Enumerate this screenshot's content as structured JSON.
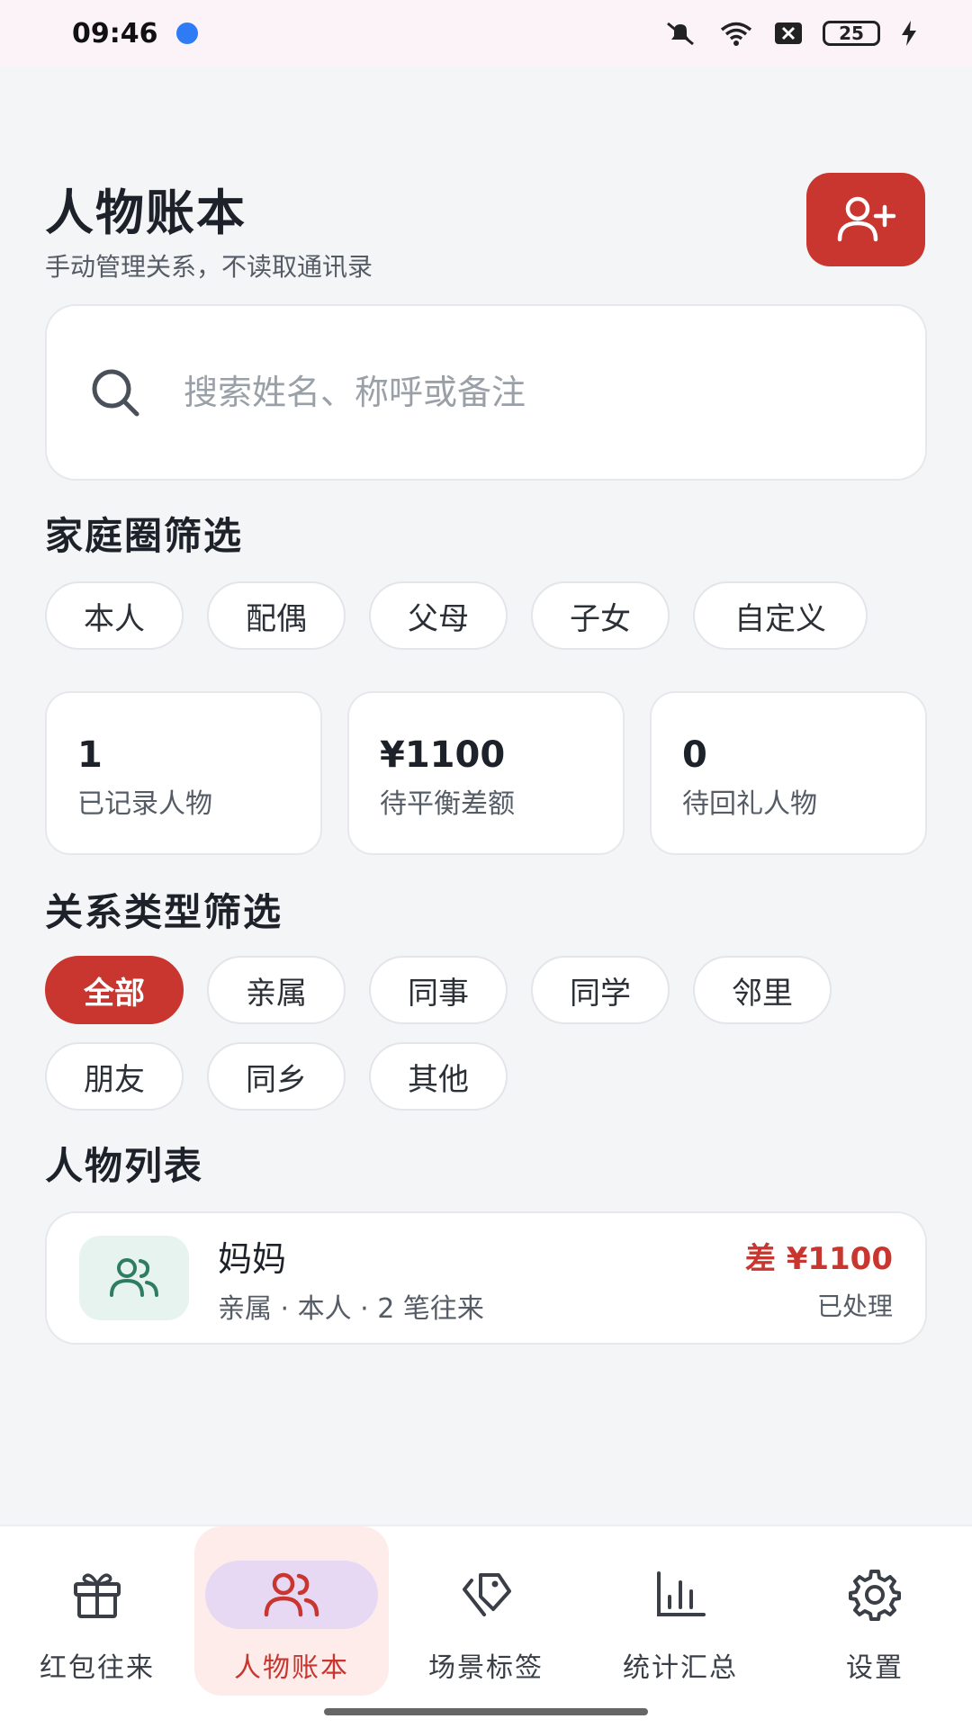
{
  "status_bar": {
    "time": "09:46",
    "battery": "25"
  },
  "header": {
    "title": "人物账本",
    "subtitle": "手动管理关系，不读取通讯录",
    "add_icon": "user-plus-icon"
  },
  "search": {
    "placeholder": "搜索姓名、称呼或备注",
    "value": ""
  },
  "family_filter": {
    "title": "家庭圈筛选",
    "chips": [
      "本人",
      "配偶",
      "父母",
      "子女",
      "自定义"
    ]
  },
  "stats": [
    {
      "value": "1",
      "label": "已记录人物"
    },
    {
      "value": "¥1100",
      "label": "待平衡差额"
    },
    {
      "value": "0",
      "label": "待回礼人物"
    }
  ],
  "relation_filter": {
    "title": "关系类型筛选",
    "row1": [
      "全部",
      "亲属",
      "同事",
      "同学",
      "邻里"
    ],
    "row2": [
      "朋友",
      "同乡",
      "其他"
    ],
    "selected": "全部"
  },
  "people": {
    "title": "人物列表",
    "items": [
      {
        "name": "妈妈",
        "meta": "亲属 · 本人 · 2 笔往来",
        "diff": "差 ¥1100",
        "status": "已处理",
        "icon": "users-icon"
      }
    ]
  },
  "nav": {
    "items": [
      {
        "label": "红包往来",
        "icon": "gift-icon"
      },
      {
        "label": "人物账本",
        "icon": "users-icon"
      },
      {
        "label": "场景标签",
        "icon": "tags-icon"
      },
      {
        "label": "统计汇总",
        "icon": "bar-chart-icon"
      },
      {
        "label": "设置",
        "icon": "gear-icon"
      }
    ],
    "active": "人物账本"
  },
  "colors": {
    "accent": "#c8362f",
    "avatar_bg": "#e6f3ef",
    "avatar_icon": "#2e7d63",
    "nav_active_pill": "#e7d8f3"
  }
}
